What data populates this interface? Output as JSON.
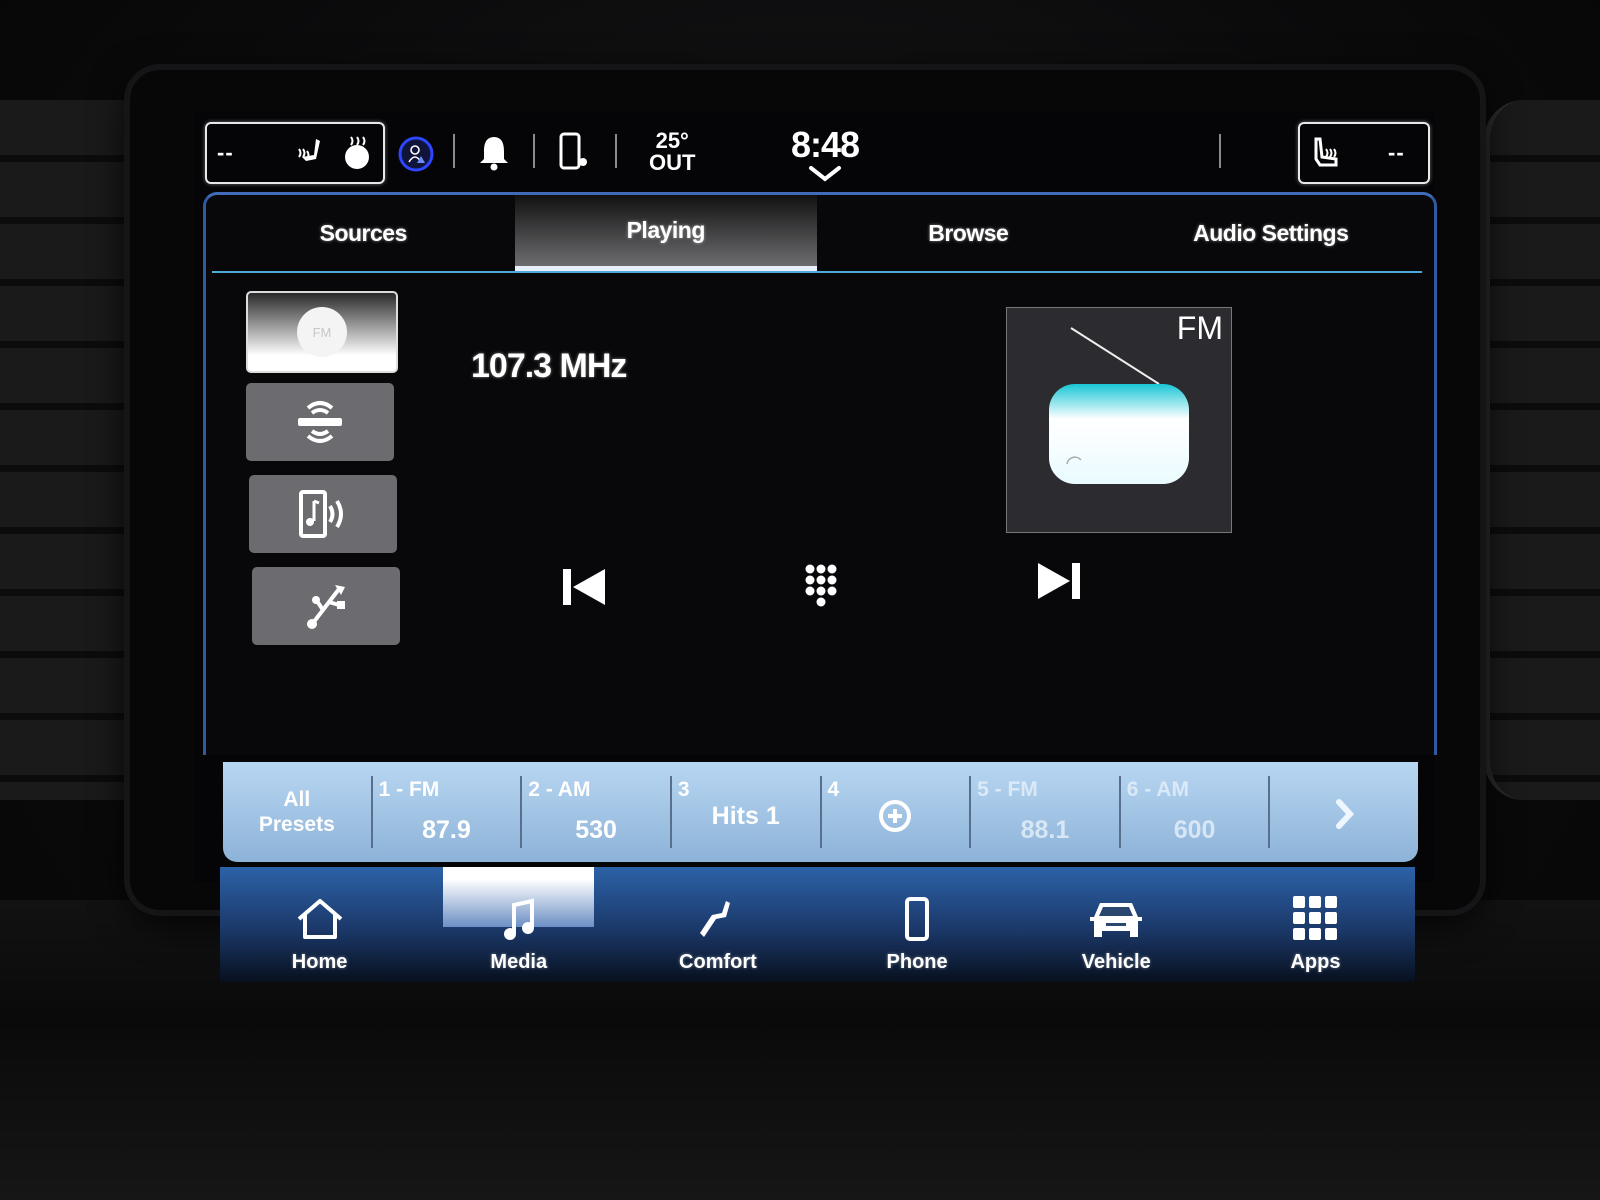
{
  "status_bar": {
    "driver_temp": "--",
    "passenger_temp": "--",
    "outside_temp": "25°",
    "outside_label": "OUT",
    "clock": "8:48",
    "icons": [
      "heated-seat-icon",
      "heated-wheel-icon",
      "driver-profile-icon",
      "bell-icon",
      "phone-connected-icon",
      "ventilated-seat-icon"
    ]
  },
  "tabs": [
    {
      "label": "Sources",
      "active": false
    },
    {
      "label": "Playing",
      "active": true
    },
    {
      "label": "Browse",
      "active": false
    },
    {
      "label": "Audio Settings",
      "active": false
    }
  ],
  "sources": [
    {
      "name": "FM radio",
      "icon": "fm-icon",
      "active": true
    },
    {
      "name": "SiriusXM",
      "icon": "satellite-radio-icon",
      "active": false
    },
    {
      "name": "Bluetooth audio",
      "icon": "bluetooth-audio-icon",
      "active": false
    },
    {
      "name": "USB",
      "icon": "usb-icon",
      "active": false
    }
  ],
  "now_playing": {
    "frequency": "107.3 MHz",
    "band_label": "FM"
  },
  "controls": {
    "prev": "seek-back-icon",
    "direct_tune": "keypad-icon",
    "next": "seek-forward-icon"
  },
  "presets": {
    "all_label_line1": "All",
    "all_label_line2": "Presets",
    "items": [
      {
        "num": "1 - FM",
        "value": "87.9"
      },
      {
        "num": "2 - AM",
        "value": "530"
      },
      {
        "num": "3",
        "value": "Hits 1"
      },
      {
        "num": "4",
        "value": ""
      },
      {
        "num": "5 - FM",
        "value": "88.1"
      },
      {
        "num": "6 - AM",
        "value": "600"
      }
    ]
  },
  "nav": [
    {
      "label": "Home",
      "active": false
    },
    {
      "label": "Media",
      "active": true
    },
    {
      "label": "Comfort",
      "active": false
    },
    {
      "label": "Phone",
      "active": false
    },
    {
      "label": "Vehicle",
      "active": false
    },
    {
      "label": "Apps",
      "active": false
    }
  ]
}
